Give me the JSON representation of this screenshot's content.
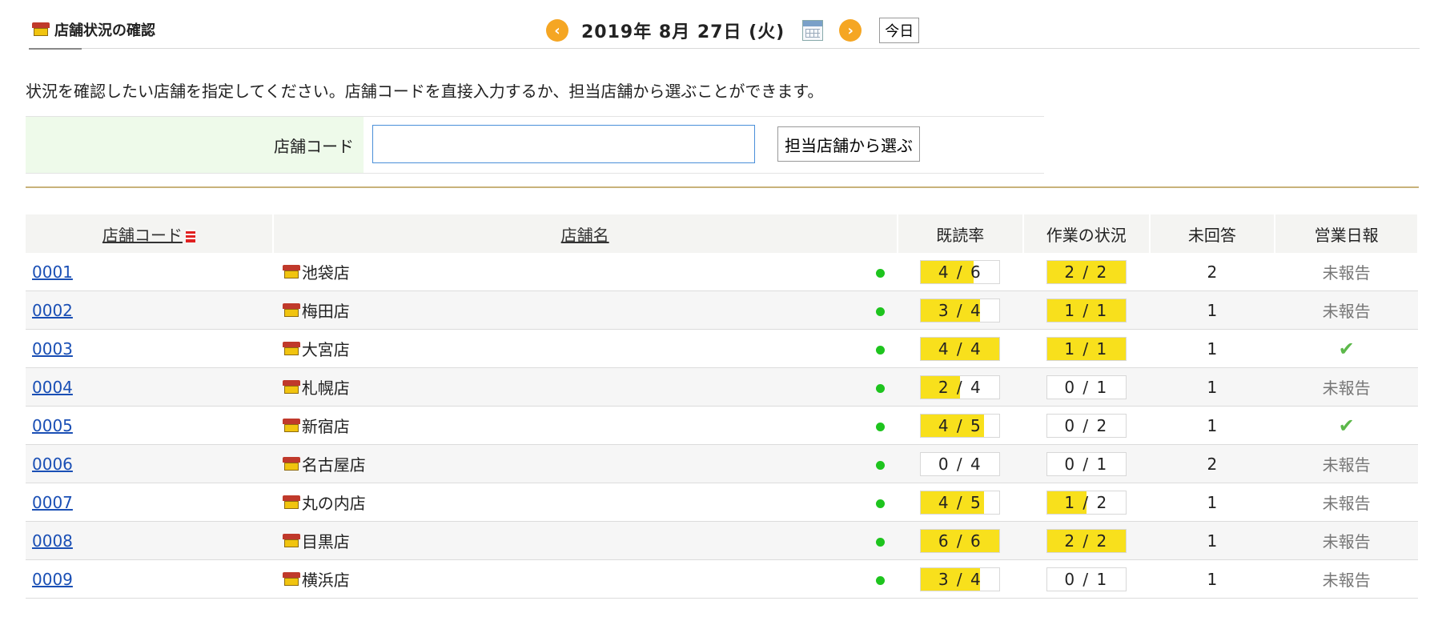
{
  "header": {
    "title": "店舗状況の確認",
    "date": "2019年 8月 27日 (火)",
    "today_label": "今日",
    "prev_icon": "chevron-left-icon",
    "next_icon": "chevron-right-icon",
    "calendar_icon": "calendar-icon"
  },
  "instruction": "状況を確認したい店舗を指定してください。店舗コードを直接入力するか、担当店舗から選ぶことができます。",
  "search": {
    "label": "店舗コード",
    "value": "",
    "placeholder": "",
    "pick_button": "担当店舗から選ぶ"
  },
  "table": {
    "columns": [
      "店舗コード",
      "店舗名",
      "既読率",
      "作業の状況",
      "未回答",
      "営業日報"
    ],
    "rows": [
      {
        "code": "0001",
        "name": "池袋店",
        "read": "4 / 6",
        "read_frac": 0.67,
        "work": "2 / 2",
        "work_frac": 1.0,
        "unanswered": "2",
        "report": "未報告"
      },
      {
        "code": "0002",
        "name": "梅田店",
        "read": "3 / 4",
        "read_frac": 0.75,
        "work": "1 / 1",
        "work_frac": 1.0,
        "unanswered": "1",
        "report": "未報告"
      },
      {
        "code": "0003",
        "name": "大宮店",
        "read": "4 / 4",
        "read_frac": 1.0,
        "work": "1 / 1",
        "work_frac": 1.0,
        "unanswered": "1",
        "report": "✔"
      },
      {
        "code": "0004",
        "name": "札幌店",
        "read": "2 / 4",
        "read_frac": 0.5,
        "work": "0 / 1",
        "work_frac": 0.0,
        "unanswered": "1",
        "report": "未報告"
      },
      {
        "code": "0005",
        "name": "新宿店",
        "read": "4 / 5",
        "read_frac": 0.8,
        "work": "0 / 2",
        "work_frac": 0.0,
        "unanswered": "1",
        "report": "✔"
      },
      {
        "code": "0006",
        "name": "名古屋店",
        "read": "0 / 4",
        "read_frac": 0.0,
        "work": "0 / 1",
        "work_frac": 0.0,
        "unanswered": "2",
        "report": "未報告"
      },
      {
        "code": "0007",
        "name": "丸の内店",
        "read": "4 / 5",
        "read_frac": 0.8,
        "work": "1 / 2",
        "work_frac": 0.5,
        "unanswered": "1",
        "report": "未報告"
      },
      {
        "code": "0008",
        "name": "目黒店",
        "read": "6 / 6",
        "read_frac": 1.0,
        "work": "2 / 2",
        "work_frac": 1.0,
        "unanswered": "1",
        "report": "未報告"
      },
      {
        "code": "0009",
        "name": "横浜店",
        "read": "3 / 4",
        "read_frac": 0.75,
        "work": "0 / 1",
        "work_frac": 0.0,
        "unanswered": "1",
        "report": "未報告"
      }
    ]
  },
  "colors": {
    "progress_fill": "#f8e01c",
    "status_dot": "#1ec41e",
    "link": "#1a4fb5",
    "nav_button": "#f5a623"
  }
}
